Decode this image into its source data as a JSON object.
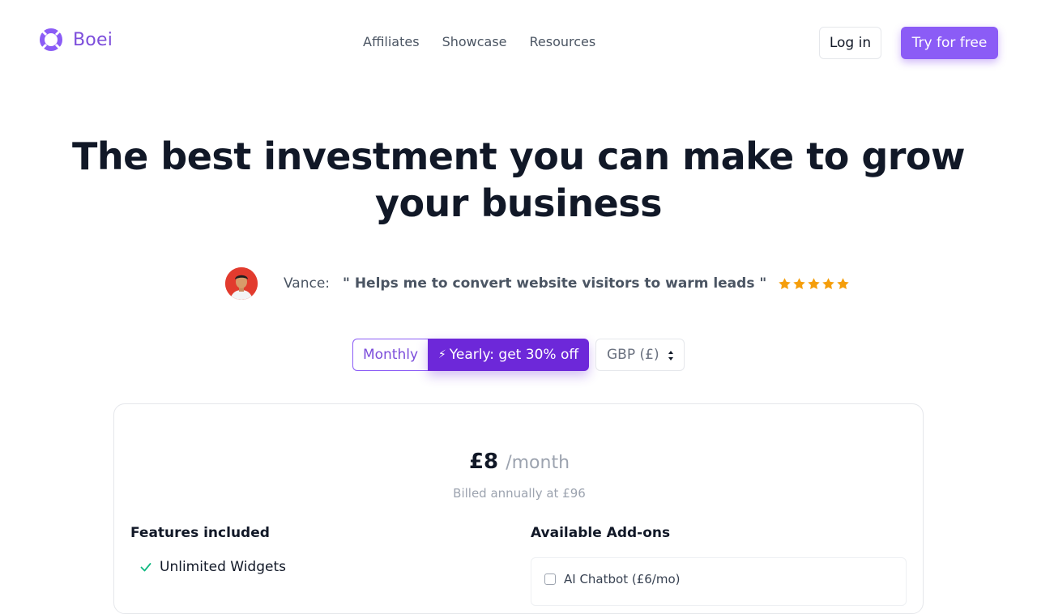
{
  "brand": {
    "name": "Boei",
    "accent": "#8b5cf6"
  },
  "nav": {
    "items": [
      "Affiliates",
      "Showcase",
      "Resources"
    ]
  },
  "header": {
    "login_label": "Log in",
    "cta_label": "Try for free"
  },
  "hero": {
    "title": "The best investment you can make to grow your business"
  },
  "testimonial": {
    "name": "Vance:",
    "quote": "\" Helps me to convert website visitors to warm leads \"",
    "rating": 5
  },
  "billing": {
    "monthly_label": "Monthly",
    "yearly_label": "Yearly: get 30% off",
    "yearly_icon": "lightning-icon",
    "currency_selected": "GBP (£)"
  },
  "plan": {
    "price": "£8",
    "period": "/month",
    "billed_note": "Billed annually at £96",
    "features_title": "Features included",
    "features": [
      "Unlimited Widgets"
    ],
    "addons_title": "Available Add-ons",
    "addons": [
      {
        "label": "AI Chatbot (£6/mo)",
        "checked": false
      }
    ]
  }
}
